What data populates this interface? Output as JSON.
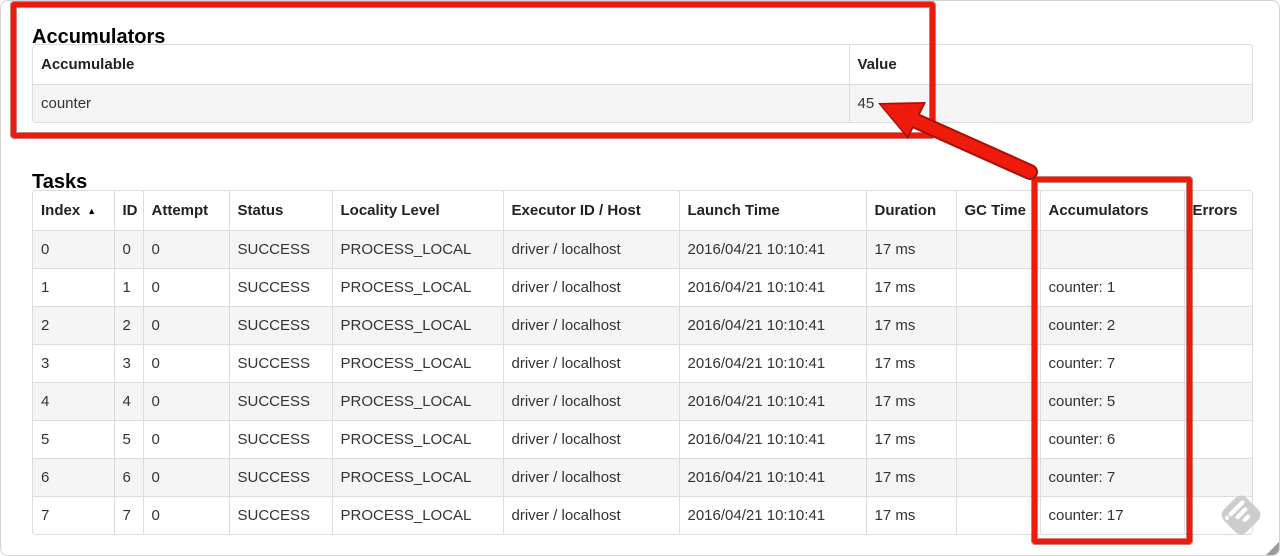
{
  "colors": {
    "annotation_red": "#ee1b0c",
    "annotation_red_dark": "#a81004",
    "stripe_gray": "#f5f5f5",
    "table_border": "#dddddd",
    "text": "#333333",
    "watermark_gray": "#c9c9c9"
  },
  "accumulators": {
    "title": "Accumulators",
    "table": {
      "headers": [
        "Accumulable",
        "Value"
      ],
      "rows": [
        [
          "counter",
          "45"
        ]
      ]
    }
  },
  "tasks": {
    "title": "Tasks",
    "table": {
      "headers": [
        "Index",
        "ID",
        "Attempt",
        "Status",
        "Locality Level",
        "Executor ID / Host",
        "Launch Time",
        "Duration",
        "GC Time",
        "Accumulators",
        "Errors"
      ],
      "sort": {
        "column": 0,
        "icon": "▲"
      },
      "rows": [
        [
          "0",
          "0",
          "0",
          "SUCCESS",
          "PROCESS_LOCAL",
          "driver / localhost",
          "2016/04/21 10:10:41",
          "17 ms",
          "",
          "",
          ""
        ],
        [
          "1",
          "1",
          "0",
          "SUCCESS",
          "PROCESS_LOCAL",
          "driver / localhost",
          "2016/04/21 10:10:41",
          "17 ms",
          "",
          "counter: 1",
          ""
        ],
        [
          "2",
          "2",
          "0",
          "SUCCESS",
          "PROCESS_LOCAL",
          "driver / localhost",
          "2016/04/21 10:10:41",
          "17 ms",
          "",
          "counter: 2",
          ""
        ],
        [
          "3",
          "3",
          "0",
          "SUCCESS",
          "PROCESS_LOCAL",
          "driver / localhost",
          "2016/04/21 10:10:41",
          "17 ms",
          "",
          "counter: 7",
          ""
        ],
        [
          "4",
          "4",
          "0",
          "SUCCESS",
          "PROCESS_LOCAL",
          "driver / localhost",
          "2016/04/21 10:10:41",
          "17 ms",
          "",
          "counter: 5",
          ""
        ],
        [
          "5",
          "5",
          "0",
          "SUCCESS",
          "PROCESS_LOCAL",
          "driver / localhost",
          "2016/04/21 10:10:41",
          "17 ms",
          "",
          "counter: 6",
          ""
        ],
        [
          "6",
          "6",
          "0",
          "SUCCESS",
          "PROCESS_LOCAL",
          "driver / localhost",
          "2016/04/21 10:10:41",
          "17 ms",
          "",
          "counter: 7",
          ""
        ],
        [
          "7",
          "7",
          "0",
          "SUCCESS",
          "PROCESS_LOCAL",
          "driver / localhost",
          "2016/04/21 10:10:41",
          "17 ms",
          "",
          "counter: 17",
          ""
        ]
      ]
    }
  }
}
